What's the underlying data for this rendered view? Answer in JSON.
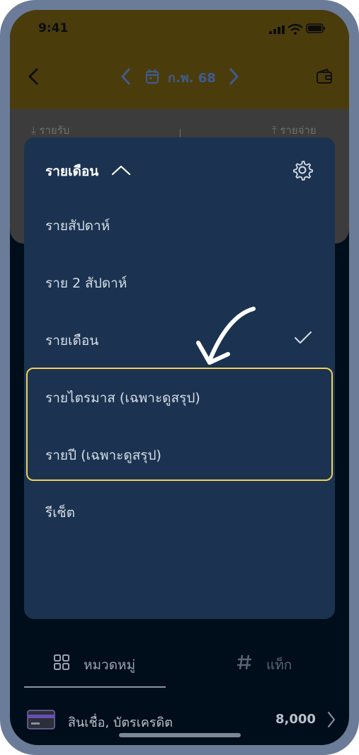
{
  "status": {
    "time": "9:41"
  },
  "header": {
    "month_label": "ก.พ. 68"
  },
  "summary": {
    "income_label": "รายรับ",
    "expense_label": "รายจ่าย"
  },
  "dropdown": {
    "title": "รายเดือน",
    "options": [
      {
        "label": "รายสัปดาห์"
      },
      {
        "label": "ราย 2 สัปดาห์"
      },
      {
        "label": "รายเดือน",
        "selected": true
      },
      {
        "label": "รายไตรมาส (เฉพาะดูสรุป)"
      },
      {
        "label": "รายปี (เฉพาะดูสรุป)"
      },
      {
        "label": "รีเซ็ต"
      }
    ]
  },
  "tabs": [
    {
      "label": "หมวดหมู่",
      "icon": "grid-icon",
      "active": true
    },
    {
      "label": "แท็ก",
      "icon": "hash-icon"
    }
  ],
  "list": [
    {
      "label": "สินเชื่อ, บัตรเครดิต",
      "value": "8,000",
      "icon": "credit-card-icon"
    }
  ],
  "colors": {
    "accent": "#3f5b8e",
    "highlight": "#f2cf5a",
    "panel": "#1b3350",
    "header_dim": "#4b3c0c"
  }
}
